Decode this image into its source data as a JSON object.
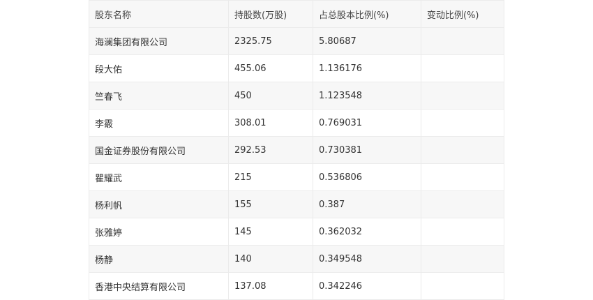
{
  "table": {
    "headers": [
      "股东名称",
      "持股数(万股)",
      "占总股本比例(%)",
      "变动比例(%)"
    ],
    "rows": [
      [
        "海澜集团有限公司",
        "2325.75",
        "5.80687",
        ""
      ],
      [
        "段大佑",
        "455.06",
        "1.136176",
        ""
      ],
      [
        "竺春飞",
        "450",
        "1.123548",
        ""
      ],
      [
        "李霰",
        "308.01",
        "0.769031",
        ""
      ],
      [
        "国金证券股份有限公司",
        "292.53",
        "0.730381",
        ""
      ],
      [
        "瞿耀武",
        "215",
        "0.536806",
        ""
      ],
      [
        "杨利帆",
        "155",
        "0.387",
        ""
      ],
      [
        "张雅婷",
        "145",
        "0.362032",
        ""
      ],
      [
        "杨静",
        "140",
        "0.349548",
        ""
      ],
      [
        "香港中央结算有限公司",
        "137.08",
        "0.342246",
        ""
      ]
    ]
  },
  "colors": {
    "row_alt": "#f7f7f7",
    "border": "#ebebeb",
    "text": "#333333"
  }
}
